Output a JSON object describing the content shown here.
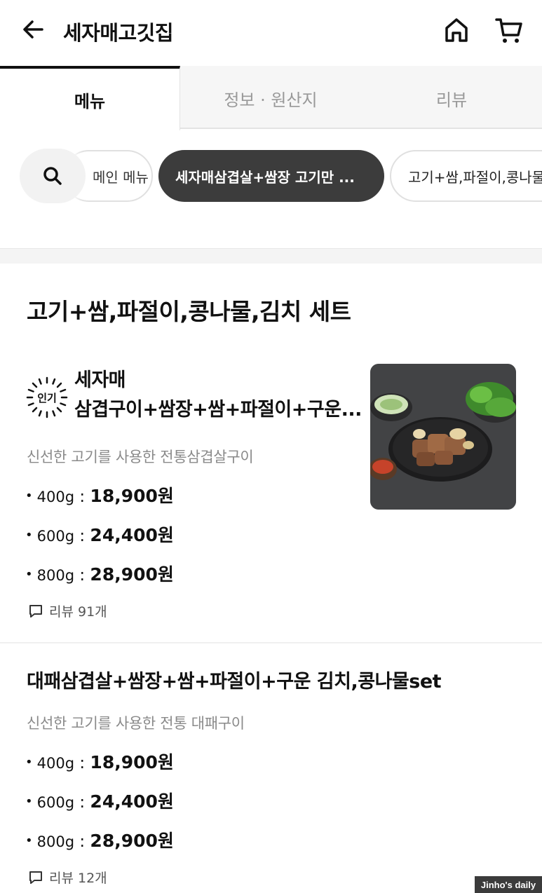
{
  "header": {
    "title": "세자매고깃집",
    "back_icon": "arrow-left-icon",
    "home_icon": "home-icon",
    "cart_icon": "cart-icon"
  },
  "tabs": [
    {
      "label": "메뉴",
      "active": true
    },
    {
      "label": "정보 · 원산지",
      "active": false
    },
    {
      "label": "리뷰",
      "active": false
    }
  ],
  "chips": [
    {
      "label": "메인 메뉴",
      "active": false
    },
    {
      "label": "세자매삼겹살+쌈장 고기만 ...",
      "active": true
    },
    {
      "label": "고기+쌈,파절이,콩나물,김치",
      "active": false
    }
  ],
  "section": {
    "title": "고기+쌈,파절이,콩나물,김치 세트"
  },
  "items": [
    {
      "badge": "인기",
      "name_line1": "세자매",
      "name_line2": "삼겹구이+쌈장+쌈+파절이+구운...",
      "description": "신선한 고기를 사용한 전통삼겹살구이",
      "prices": [
        {
          "weight": "400g",
          "price": "18,900원"
        },
        {
          "weight": "600g",
          "price": "24,400원"
        },
        {
          "weight": "800g",
          "price": "28,900원"
        }
      ],
      "review": "리뷰 91개"
    },
    {
      "name": "대패삼겹살+쌈장+쌈+파절이+구운 김치,콩나물set",
      "description": "신선한 고기를 사용한 전통 대패구이",
      "prices": [
        {
          "weight": "400g",
          "price": "18,900원"
        },
        {
          "weight": "600g",
          "price": "24,400원"
        },
        {
          "weight": "800g",
          "price": "28,900원"
        }
      ],
      "review": "리뷰 12개"
    }
  ],
  "watermark": "Jinho's daily"
}
